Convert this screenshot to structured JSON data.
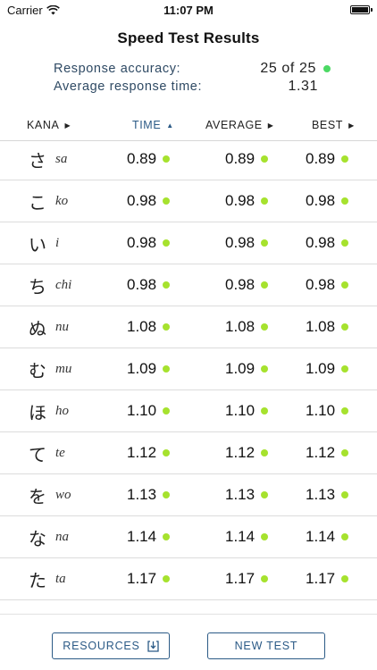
{
  "status": {
    "carrier": "Carrier",
    "time": "11:07 PM"
  },
  "title": "Speed Test Results",
  "summary": {
    "accuracy_label": "Response accuracy:",
    "accuracy_value": "25 of 25",
    "avg_label": "Average response time:",
    "avg_value": "1.31"
  },
  "columns": {
    "kana": "KANA",
    "time": "TIME",
    "average": "AVERAGE",
    "best": "BEST",
    "sorted_by": "time",
    "sort_direction": "ascending"
  },
  "rows": [
    {
      "kana": "さ",
      "romaji": "sa",
      "time": "0.89",
      "average": "0.89",
      "best": "0.89"
    },
    {
      "kana": "こ",
      "romaji": "ko",
      "time": "0.98",
      "average": "0.98",
      "best": "0.98"
    },
    {
      "kana": "い",
      "romaji": "i",
      "time": "0.98",
      "average": "0.98",
      "best": "0.98"
    },
    {
      "kana": "ち",
      "romaji": "chi",
      "time": "0.98",
      "average": "0.98",
      "best": "0.98"
    },
    {
      "kana": "ぬ",
      "romaji": "nu",
      "time": "1.08",
      "average": "1.08",
      "best": "1.08"
    },
    {
      "kana": "む",
      "romaji": "mu",
      "time": "1.09",
      "average": "1.09",
      "best": "1.09"
    },
    {
      "kana": "ほ",
      "romaji": "ho",
      "time": "1.10",
      "average": "1.10",
      "best": "1.10"
    },
    {
      "kana": "て",
      "romaji": "te",
      "time": "1.12",
      "average": "1.12",
      "best": "1.12"
    },
    {
      "kana": "を",
      "romaji": "wo",
      "time": "1.13",
      "average": "1.13",
      "best": "1.13"
    },
    {
      "kana": "な",
      "romaji": "na",
      "time": "1.14",
      "average": "1.14",
      "best": "1.14"
    },
    {
      "kana": "た",
      "romaji": "ta",
      "time": "1.17",
      "average": "1.17",
      "best": "1.17"
    }
  ],
  "buttons": {
    "resources": "RESOURCES",
    "new_test": "NEW TEST"
  },
  "colors": {
    "accent": "#2b5a86",
    "dot": "#a6e22e",
    "accuracy_dot": "#4cd964"
  },
  "icons": {
    "resources_button": "download-icon",
    "sort_indicator": "triangle-icon"
  }
}
